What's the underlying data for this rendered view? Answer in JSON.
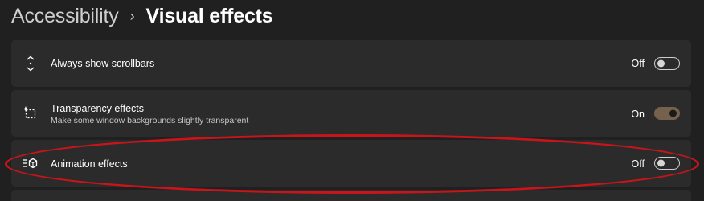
{
  "breadcrumb": {
    "parent": "Accessibility",
    "separator": "›",
    "current": "Visual effects"
  },
  "settings": [
    {
      "label": "Always show scrollbars",
      "description": "",
      "icon": "scrollbars-icon",
      "state": "Off",
      "on": false
    },
    {
      "label": "Transparency effects",
      "description": "Make some window backgrounds slightly transparent",
      "icon": "transparency-icon",
      "state": "On",
      "on": true
    },
    {
      "label": "Animation effects",
      "description": "",
      "icon": "animation-icon",
      "state": "Off",
      "on": false
    }
  ],
  "colors": {
    "background": "#202020",
    "card": "#2b2b2b",
    "toggle_on": "#76624c",
    "annotation": "#c8141a"
  }
}
